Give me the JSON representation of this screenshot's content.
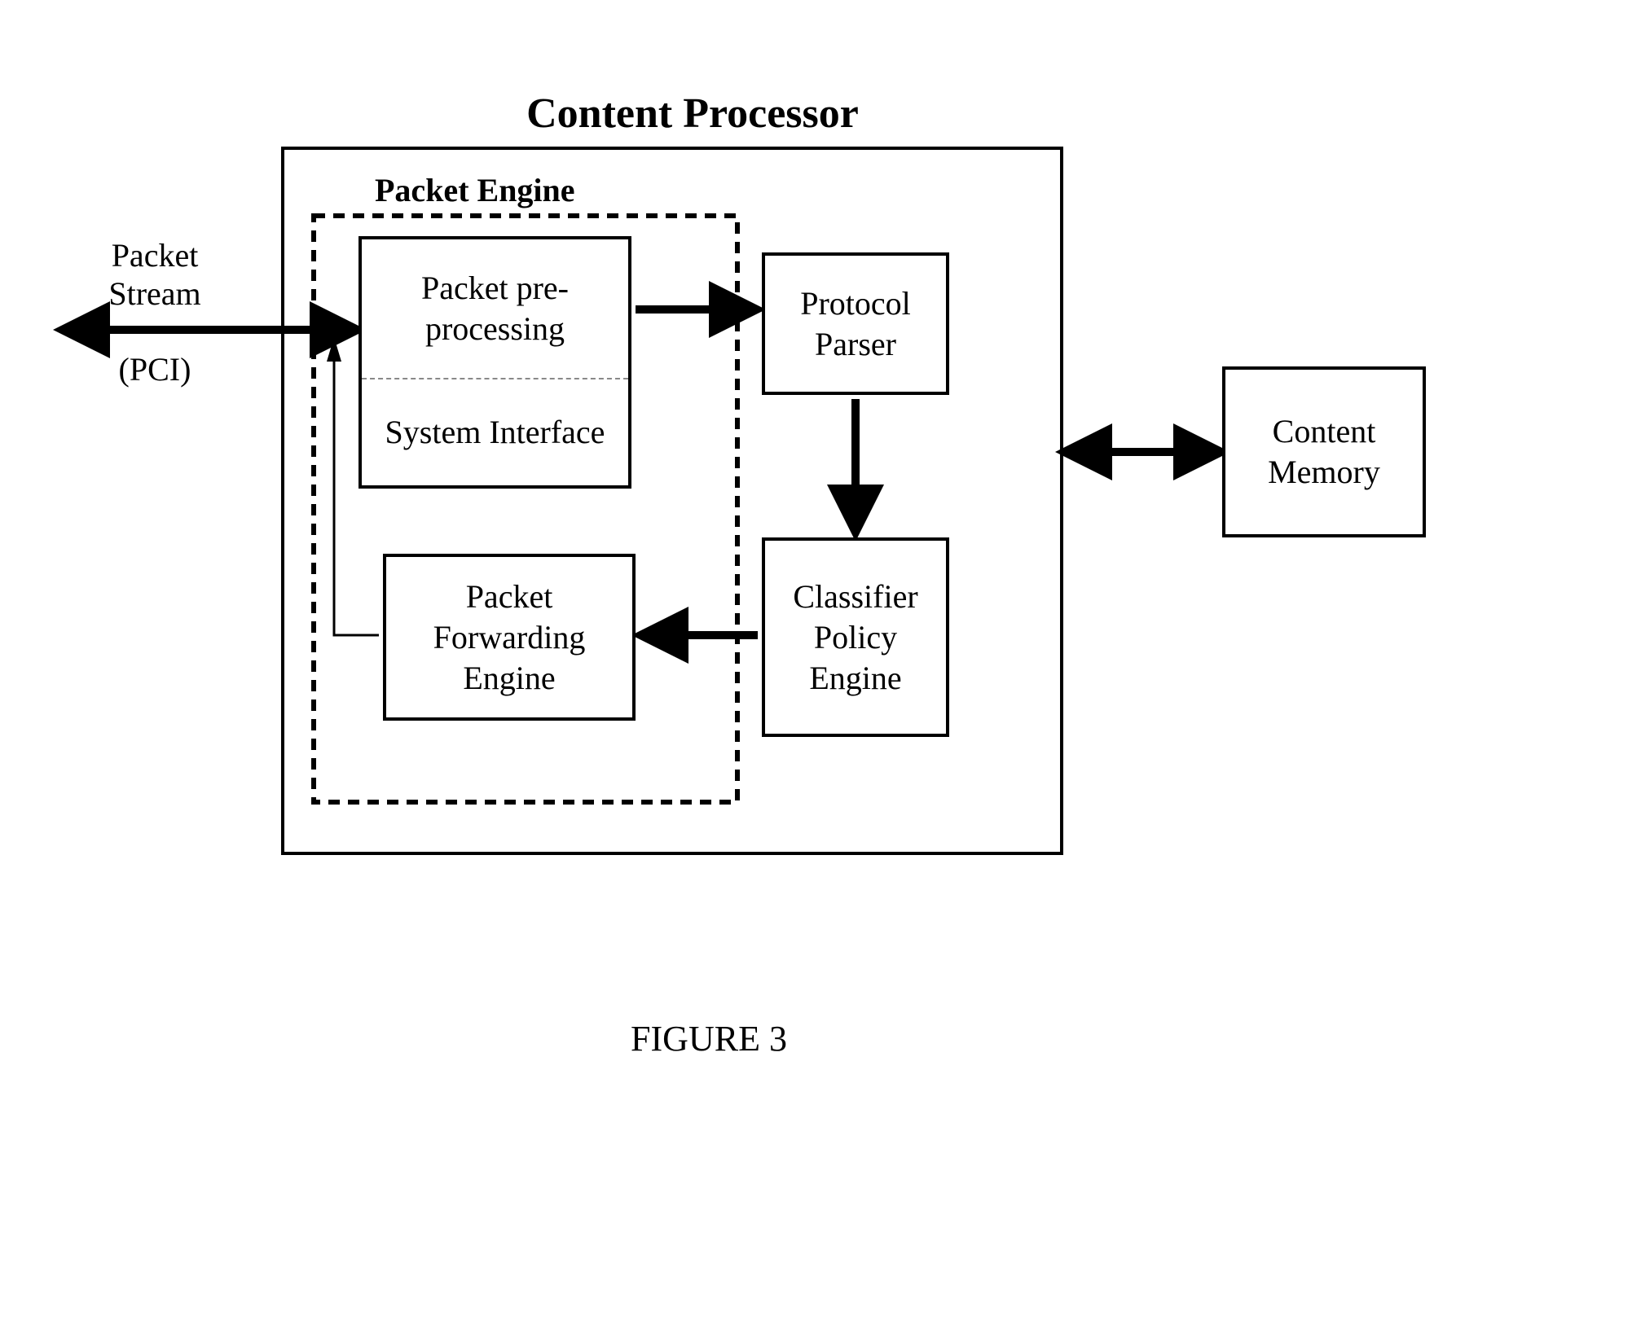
{
  "title": "Content Processor",
  "packet_engine_label": "Packet Engine",
  "external": {
    "packet_stream": "Packet Stream",
    "pci": "(PCI)"
  },
  "blocks": {
    "packet_preprocessing": "Packet pre-processing",
    "system_interface": "System Interface",
    "protocol_parser": "Protocol Parser",
    "classifier_policy_engine": "Classifier Policy Engine",
    "packet_forwarding_engine": "Packet Forwarding Engine",
    "content_memory": "Content Memory"
  },
  "caption": "FIGURE 3",
  "connections": [
    {
      "from": "external-left",
      "to": "packet-engine",
      "type": "bidirectional-thick",
      "label": "Packet Stream (PCI)"
    },
    {
      "from": "packet-preprocessing",
      "to": "protocol-parser",
      "type": "thick-arrow"
    },
    {
      "from": "protocol-parser",
      "to": "classifier-policy-engine",
      "type": "thick-arrow"
    },
    {
      "from": "classifier-policy-engine",
      "to": "packet-forwarding-engine",
      "type": "thick-arrow"
    },
    {
      "from": "packet-forwarding-engine",
      "to": "packet-stream-connector",
      "type": "thin-arrow"
    },
    {
      "from": "content-processor",
      "to": "content-memory",
      "type": "bidirectional-thick"
    }
  ]
}
